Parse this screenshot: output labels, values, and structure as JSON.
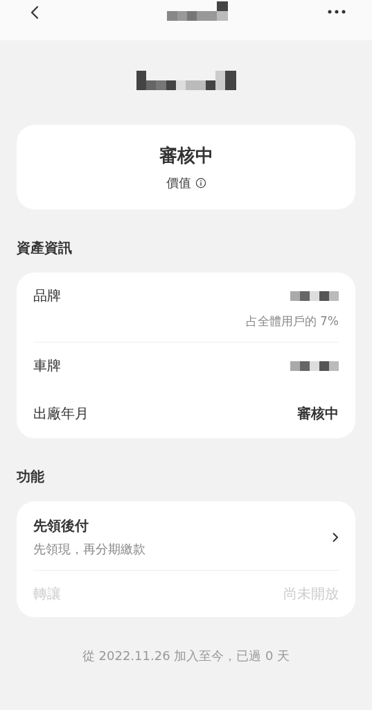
{
  "status_card": {
    "status": "審核中",
    "label": "價值"
  },
  "asset_section": {
    "title": "資產資訊",
    "rows": [
      {
        "kind": "masked",
        "label": "品牌",
        "note": "占全體用戶的 7%"
      },
      {
        "kind": "masked",
        "label": "車牌"
      },
      {
        "kind": "text",
        "label": "出廠年月",
        "value": "審核中"
      }
    ]
  },
  "feature_section": {
    "title": "功能",
    "items": [
      {
        "title": "先領後付",
        "subtitle": "先領現，再分期繳款",
        "disabled": false
      },
      {
        "title": "轉讓",
        "status": "尚未開放",
        "disabled": true
      }
    ]
  },
  "footer": "從 2022.11.26 加入至今，已過 0 天"
}
